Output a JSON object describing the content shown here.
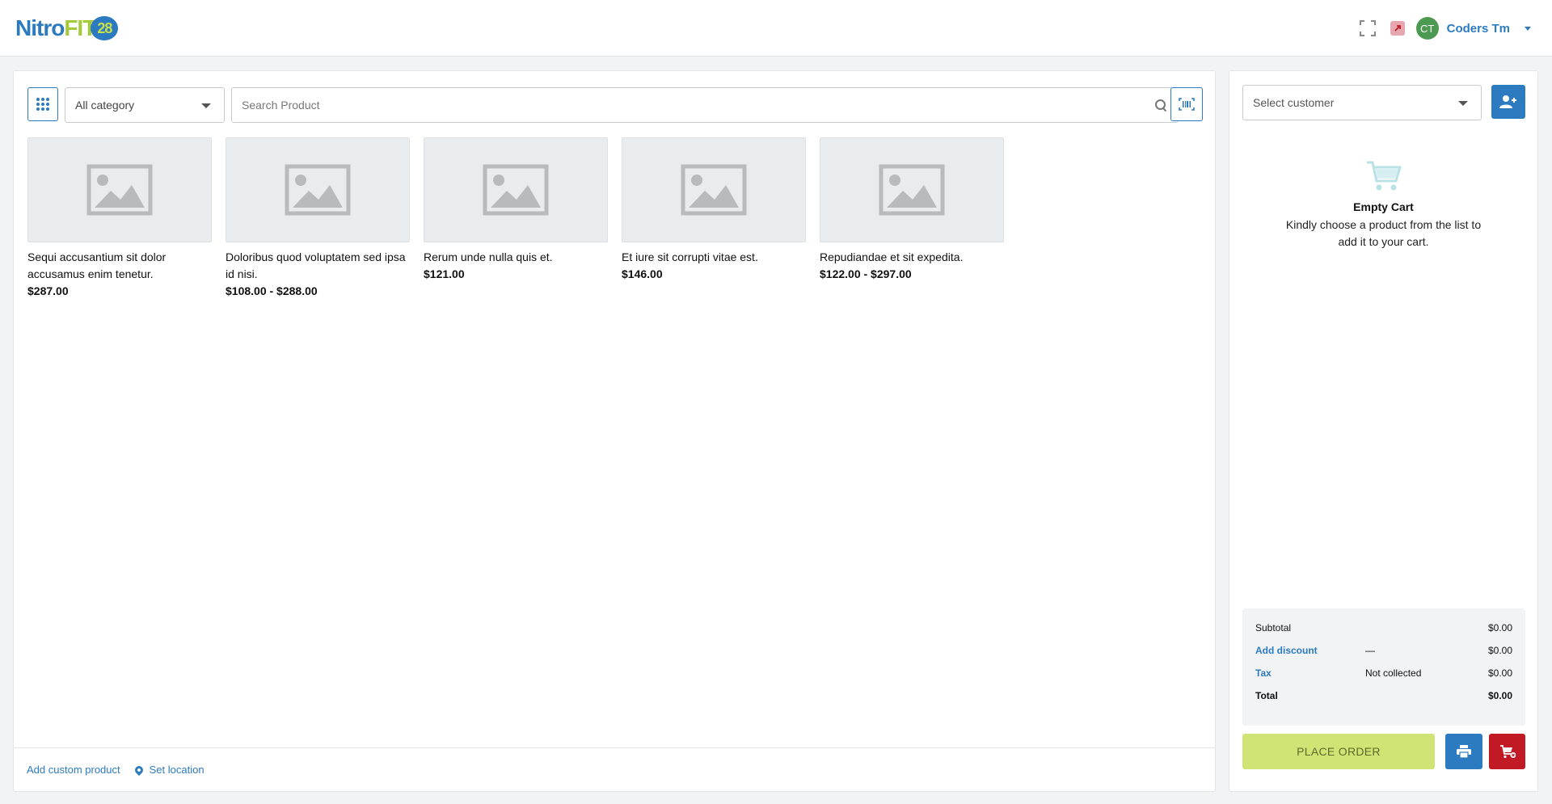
{
  "header": {
    "logo": {
      "part1": "Nitro",
      "part2": "FIT",
      "part3": "28"
    },
    "user": {
      "initials": "CT",
      "name": "Coders Tm"
    },
    "icons": {
      "fullscreen": "expand-icon",
      "external": "external-link-icon",
      "menu": "chevron-down-icon"
    }
  },
  "toolbar": {
    "category_selected": "All category",
    "search_placeholder": "Search Product"
  },
  "products": [
    {
      "name": "Sequi accusantium sit dolor accusamus enim tenetur.",
      "price": "$287.00"
    },
    {
      "name": "Doloribus quod voluptatem sed ipsa id nisi.",
      "price": "$108.00 - $288.00"
    },
    {
      "name": "Rerum unde nulla quis et.",
      "price": "$121.00"
    },
    {
      "name": "Et iure sit corrupti vitae est.",
      "price": "$146.00"
    },
    {
      "name": "Repudiandae et sit expedita.",
      "price": "$122.00 - $297.00"
    }
  ],
  "footer": {
    "add_custom": "Add custom product",
    "set_location": "Set location"
  },
  "cart": {
    "customer_placeholder": "Select customer",
    "empty_title": "Empty Cart",
    "empty_text": "Kindly choose a product from the list to add it to your cart.",
    "summary": {
      "subtotal_label": "Subtotal",
      "subtotal_value": "$0.00",
      "discount_label": "Add discount",
      "discount_mid": "—",
      "discount_value": "$0.00",
      "tax_label": "Tax",
      "tax_mid": "Not collected",
      "tax_value": "$0.00",
      "total_label": "Total",
      "total_value": "$0.00"
    },
    "place_order": "PLACE ORDER"
  },
  "colors": {
    "primary": "#2c7bc0",
    "accent": "#cfe474",
    "danger": "#c21a24",
    "avatar": "#4c9a52"
  }
}
